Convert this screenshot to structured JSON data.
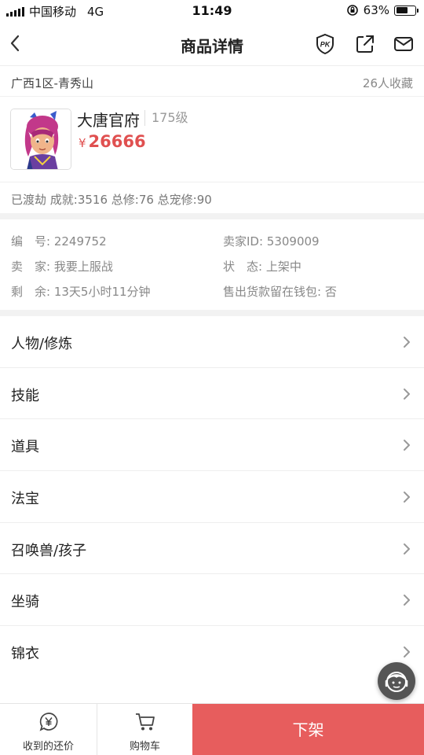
{
  "status_bar": {
    "carrier": "中国移动",
    "network": "4G",
    "time": "11:49",
    "battery": "63%",
    "battery_level": 0.63
  },
  "nav": {
    "title": "商品详情",
    "icons": [
      "back-icon",
      "pk-icon",
      "share-icon",
      "mail-icon"
    ]
  },
  "server": {
    "name": "广西1区-青秀山",
    "favorites": "26人收藏"
  },
  "item": {
    "name": "大唐官府",
    "level": "175级",
    "price_symbol": "¥",
    "price": "26666",
    "achievements": "已渡劫 成就:3516 总修:76 总宠修:90"
  },
  "info": {
    "serial": "编　号: 2249752",
    "seller_id": "卖家ID: 5309009",
    "seller": "卖　家: 我要上服战",
    "status": "状　态: 上架中",
    "remaining": "剩　余: 13天5小时11分钟",
    "wallet": "售出货款留在钱包: 否"
  },
  "menu": [
    {
      "label": "人物/修炼"
    },
    {
      "label": "技能"
    },
    {
      "label": "道具"
    },
    {
      "label": "法宝"
    },
    {
      "label": "召唤兽/孩子"
    },
    {
      "label": "坐骑"
    },
    {
      "label": "锦衣"
    }
  ],
  "bottom": {
    "offers_label": "收到的还价",
    "cart_label": "购物车",
    "offshelf_label": "下架"
  },
  "colors": {
    "accent": "#e75d5d",
    "price": "#e05050"
  }
}
